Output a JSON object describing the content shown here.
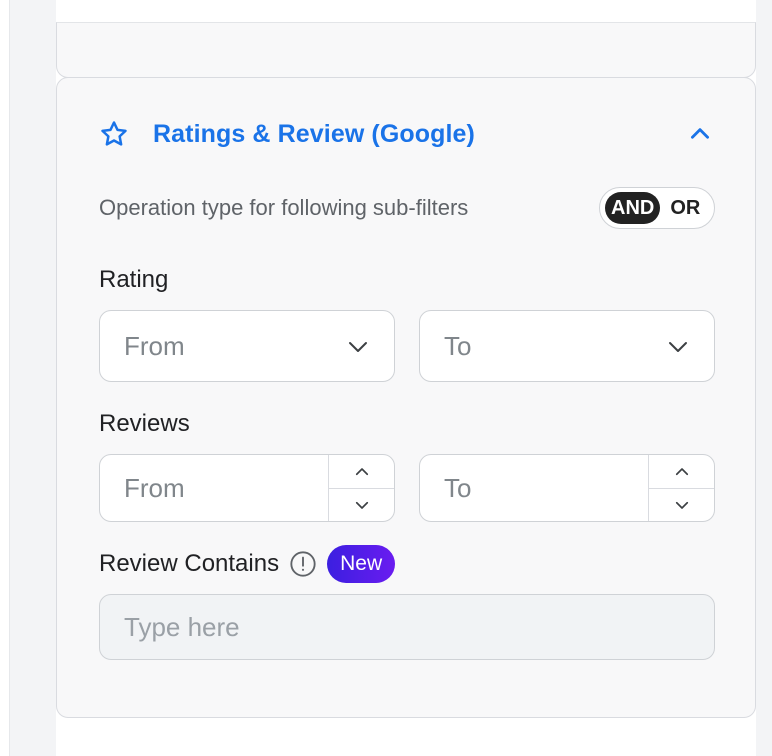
{
  "panel": {
    "title": "Ratings & Review (Google)",
    "icons": {
      "header": "star-icon",
      "collapse": "chevron-up-icon",
      "dropdown": "chevron-down-icon",
      "increment": "chevron-up-icon",
      "decrement": "chevron-down-icon",
      "info": "info-icon"
    },
    "accent_color": "#1a73e8"
  },
  "operation": {
    "label": "Operation type for following sub-filters",
    "options": [
      "AND",
      "OR"
    ],
    "selected": "AND"
  },
  "rating": {
    "label": "Rating",
    "from_placeholder": "From",
    "to_placeholder": "To"
  },
  "reviews": {
    "label": "Reviews",
    "from_placeholder": "From",
    "to_placeholder": "To"
  },
  "review_contains": {
    "label": "Review Contains",
    "badge": "New",
    "placeholder": "Type here"
  }
}
